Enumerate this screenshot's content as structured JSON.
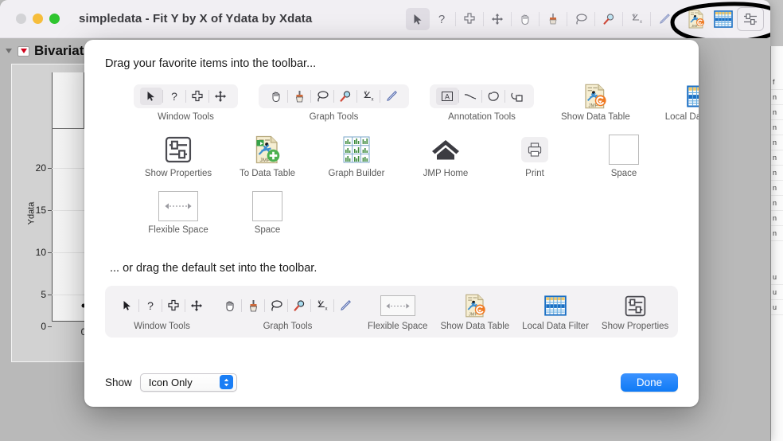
{
  "window": {
    "title": "simpledata - Fit Y by X of Ydata by Xdata",
    "traffic": {
      "close": "close-button",
      "minimize": "minimize-button",
      "zoom": "zoom-button"
    }
  },
  "toolbar": {
    "items": [
      {
        "name": "arrow-select-icon",
        "selected": true
      },
      {
        "name": "question-help-icon",
        "selected": false
      },
      {
        "name": "crosshair-select-icon",
        "selected": false
      },
      {
        "name": "move-arrows-icon",
        "selected": false
      },
      {
        "name": "grabber-hand-icon",
        "selected": false
      },
      {
        "name": "brush-icon",
        "selected": false
      },
      {
        "name": "lasso-icon",
        "selected": false
      },
      {
        "name": "magnifier-icon",
        "selected": false
      },
      {
        "name": "crosshairs-icon",
        "selected": false
      },
      {
        "name": "annotate-pencil-icon",
        "selected": false
      },
      {
        "name": "show-data-table-icon",
        "selected": false
      },
      {
        "name": "local-data-filter-icon",
        "selected": true
      },
      {
        "name": "show-properties-icon",
        "selected": false
      }
    ],
    "annotation": "hand-drawn-ellipse"
  },
  "report": {
    "outline_title": "Bivariate",
    "chart": {
      "ylabel": "Ydata",
      "yticks": [
        "20",
        "15",
        "10",
        "5",
        "0"
      ],
      "xticks": [
        "0"
      ]
    }
  },
  "dialog": {
    "heading": "Drag your favorite items into the toolbar...",
    "subheading": "... or drag the default set into the toolbar.",
    "palette_rows": [
      [
        {
          "label": "Window Tools",
          "type": "group",
          "icons": [
            "arrow-select-icon",
            "question-help-icon",
            "crosshair-select-icon",
            "move-arrows-icon"
          ]
        },
        {
          "label": "Graph Tools",
          "type": "group",
          "icons": [
            "grabber-hand-icon",
            "brush-icon",
            "lasso-icon",
            "magnifier-icon",
            "crosshairs-icon",
            "annotate-pencil-icon"
          ]
        },
        {
          "label": "Annotation Tools",
          "type": "group",
          "icons": [
            "text-annotation-icon",
            "line-icon",
            "shape-icon",
            "copy-shape-icon"
          ]
        },
        {
          "label": "Show Data Table",
          "type": "single",
          "icon": "show-data-table-icon"
        },
        {
          "label": "Local Data Filter",
          "type": "single",
          "icon": "local-data-filter-icon"
        }
      ],
      [
        {
          "label": "Show Properties",
          "type": "single",
          "icon": "show-properties-icon"
        },
        {
          "label": "To Data Table",
          "type": "single",
          "icon": "to-data-table-icon"
        },
        {
          "label": "Graph Builder",
          "type": "single",
          "icon": "graph-builder-icon"
        },
        {
          "label": "JMP Home",
          "type": "single",
          "icon": "jmp-home-icon"
        },
        {
          "label": "Print",
          "type": "single",
          "icon": "print-icon"
        },
        {
          "label": "Space",
          "type": "single",
          "icon": "space-icon"
        }
      ],
      [
        {
          "label": "Flexible Space",
          "type": "single",
          "icon": "flexible-space-icon"
        },
        {
          "label": "Space",
          "type": "single",
          "icon": "space-icon"
        }
      ]
    ],
    "default_set": [
      {
        "label": "Window Tools",
        "type": "group",
        "icons": [
          "arrow-select-icon",
          "question-help-icon",
          "crosshair-select-icon",
          "move-arrows-icon"
        ]
      },
      {
        "label": "Graph Tools",
        "type": "group",
        "icons": [
          "grabber-hand-icon",
          "brush-icon",
          "lasso-icon",
          "magnifier-icon",
          "crosshairs-icon",
          "annotate-pencil-icon"
        ]
      },
      {
        "label": "Flexible Space",
        "type": "single",
        "icon": "flexible-space-icon"
      },
      {
        "label": "Show Data Table",
        "type": "single",
        "icon": "show-data-table-icon"
      },
      {
        "label": "Local Data Filter",
        "type": "single",
        "icon": "local-data-filter-icon"
      },
      {
        "label": "Show Properties",
        "type": "single",
        "icon": "show-properties-icon"
      }
    ],
    "footer": {
      "show_label": "Show",
      "show_value": "Icon Only",
      "done_label": "Done"
    }
  },
  "background_list": [
    "f",
    "n",
    "n",
    "n",
    "n",
    "n",
    "n",
    "n",
    "n",
    "n",
    "n",
    "u",
    "u",
    "u"
  ],
  "colors": {
    "accent_blue": "#0f7bf5",
    "window_chrome": "#f1eff3",
    "sheet_bg": "#ffffff",
    "group_bg": "#f3f2f4",
    "desktop": "#b9b9b9"
  }
}
